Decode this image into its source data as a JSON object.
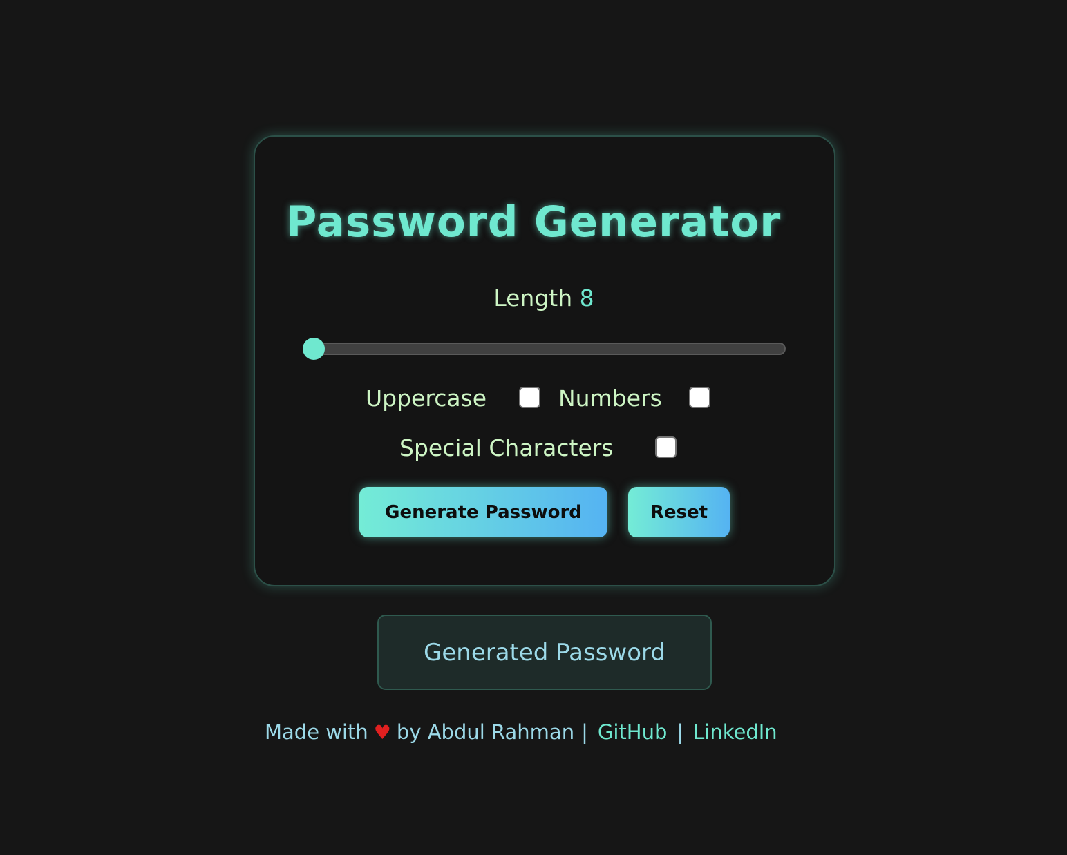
{
  "card": {
    "title": "Password Generator",
    "length_label": "Length",
    "length_value": "8",
    "options": {
      "uppercase_label": "Uppercase",
      "numbers_label": "Numbers",
      "special_label": "Special Characters"
    },
    "buttons": {
      "generate_label": "Generate Password",
      "reset_label": "Reset"
    }
  },
  "output": {
    "placeholder": "Generated Password"
  },
  "footer": {
    "made_with": "Made with",
    "heart": "♥",
    "by_author": "by Abdul Rahman",
    "separator": "|",
    "github_label": "GitHub",
    "linkedin_label": "LinkedIn"
  },
  "colors": {
    "accent": "#6fe8cf",
    "label": "#cdf5c4",
    "background": "#161616",
    "gradient_start": "#74ecd6",
    "gradient_end": "#55b3f2",
    "heart": "#e02020"
  },
  "state": {
    "uppercase_checked": false,
    "numbers_checked": false,
    "special_checked": false,
    "slider_position_fraction": 0
  }
}
